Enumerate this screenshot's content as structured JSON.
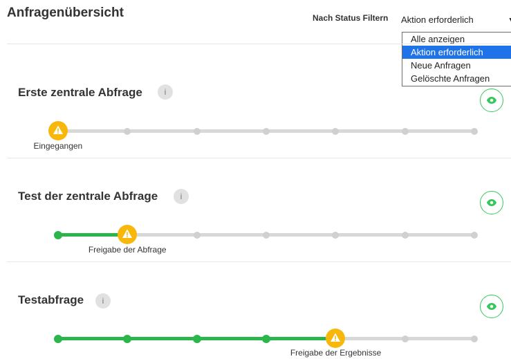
{
  "page": {
    "title": "Anfragenübersicht"
  },
  "filter": {
    "label": "Nach Status Filtern",
    "selected": "Aktion erforderlich",
    "options": [
      "Alle anzeigen",
      "Aktion erforderlich",
      "Neue Anfragen",
      "Gelöschte Anfragen"
    ]
  },
  "requests": [
    {
      "title": "Erste zentrale Abfrage",
      "info": "i",
      "current_step": 1,
      "total_steps": 7,
      "current_label": "Eingegangen"
    },
    {
      "title": "Test der zentrale Abfrage",
      "info": "i",
      "current_step": 2,
      "total_steps": 7,
      "current_label": "Freigabe der Abfrage"
    },
    {
      "title": "Testabfrage",
      "info": "i",
      "current_step": 5,
      "total_steps": 7,
      "current_label": "Freigabe der Ergebnisse"
    }
  ],
  "colors": {
    "accent_green": "#2cb54a",
    "warning": "#f8b70b",
    "track": "#d8d8d8",
    "selected_option": "#1e73e8"
  },
  "icons": {
    "warning": "warning-icon",
    "eye": "eye-icon",
    "info": "info-icon",
    "chevron": "chevron-down-icon"
  }
}
